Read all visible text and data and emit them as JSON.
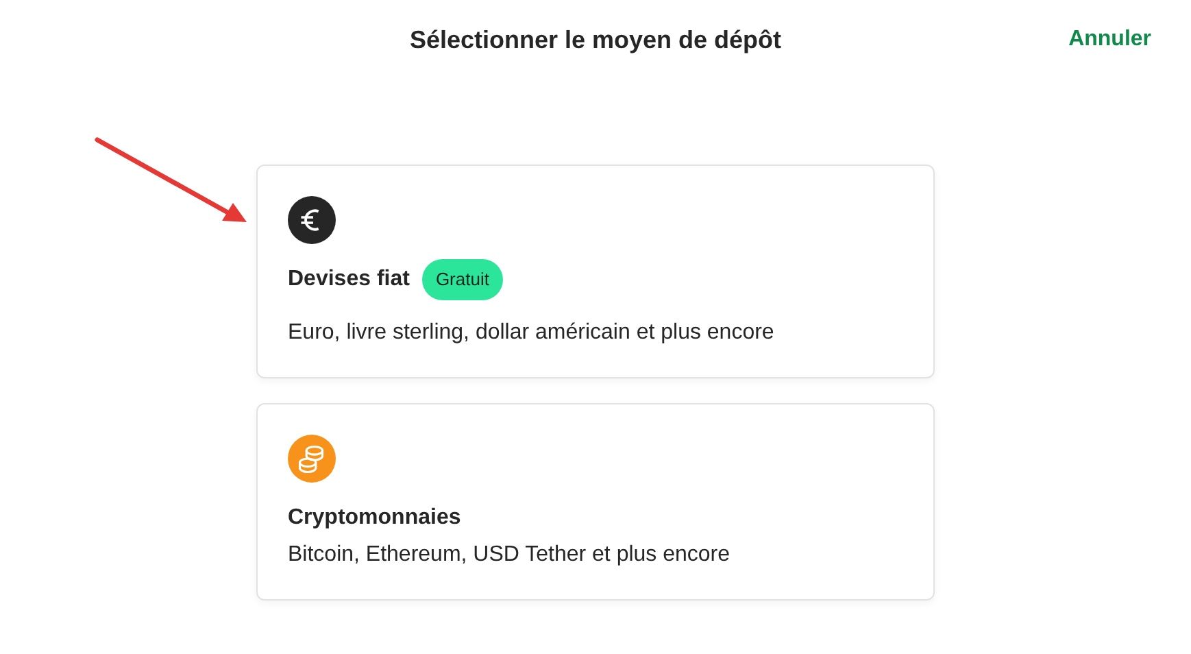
{
  "header": {
    "title": "Sélectionner le moyen de dépôt",
    "cancel": "Annuler"
  },
  "options": [
    {
      "kind": "fiat",
      "title": "Devises fiat",
      "badge": "Gratuit",
      "description": "Euro, livre sterling, dollar américain et plus encore"
    },
    {
      "kind": "crypto",
      "title": "Cryptomonnaies",
      "description": "Bitcoin, Ethereum, USD Tether et plus encore"
    }
  ]
}
